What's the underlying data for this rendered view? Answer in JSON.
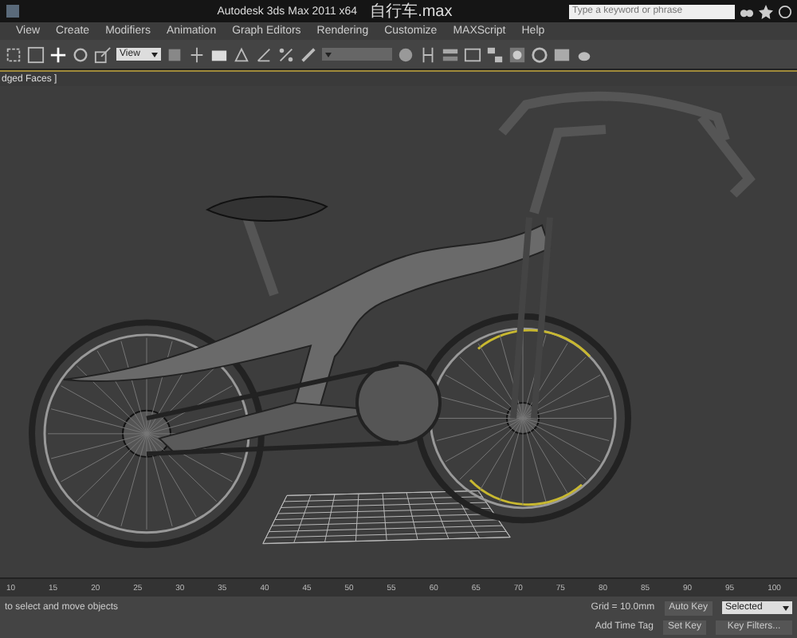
{
  "window": {
    "title": "Autodesk 3ds Max  2011 x64",
    "file": "自行车.max"
  },
  "search": {
    "placeholder": "Type a keyword or phrase"
  },
  "menu": [
    "View",
    "Create",
    "Modifiers",
    "Animation",
    "Graph Editors",
    "Rendering",
    "Customize",
    "MAXScript",
    "Help"
  ],
  "toolbar": {
    "reference_dropdown": "View"
  },
  "viewport": {
    "label": "dged Faces ]"
  },
  "timeline": {
    "ticks": [
      "10",
      "15",
      "20",
      "25",
      "30",
      "35",
      "40",
      "45",
      "50",
      "55",
      "60",
      "65",
      "70",
      "75",
      "80",
      "85",
      "90",
      "95",
      "100"
    ]
  },
  "status": {
    "prompt": "to select and move objects",
    "grid": "Grid = 10.0mm",
    "time_tag": "Add Time Tag",
    "auto_key": "Auto Key",
    "key_mode": "Selected",
    "set_key": "Set Key",
    "key_filters": "Key Filters..."
  }
}
